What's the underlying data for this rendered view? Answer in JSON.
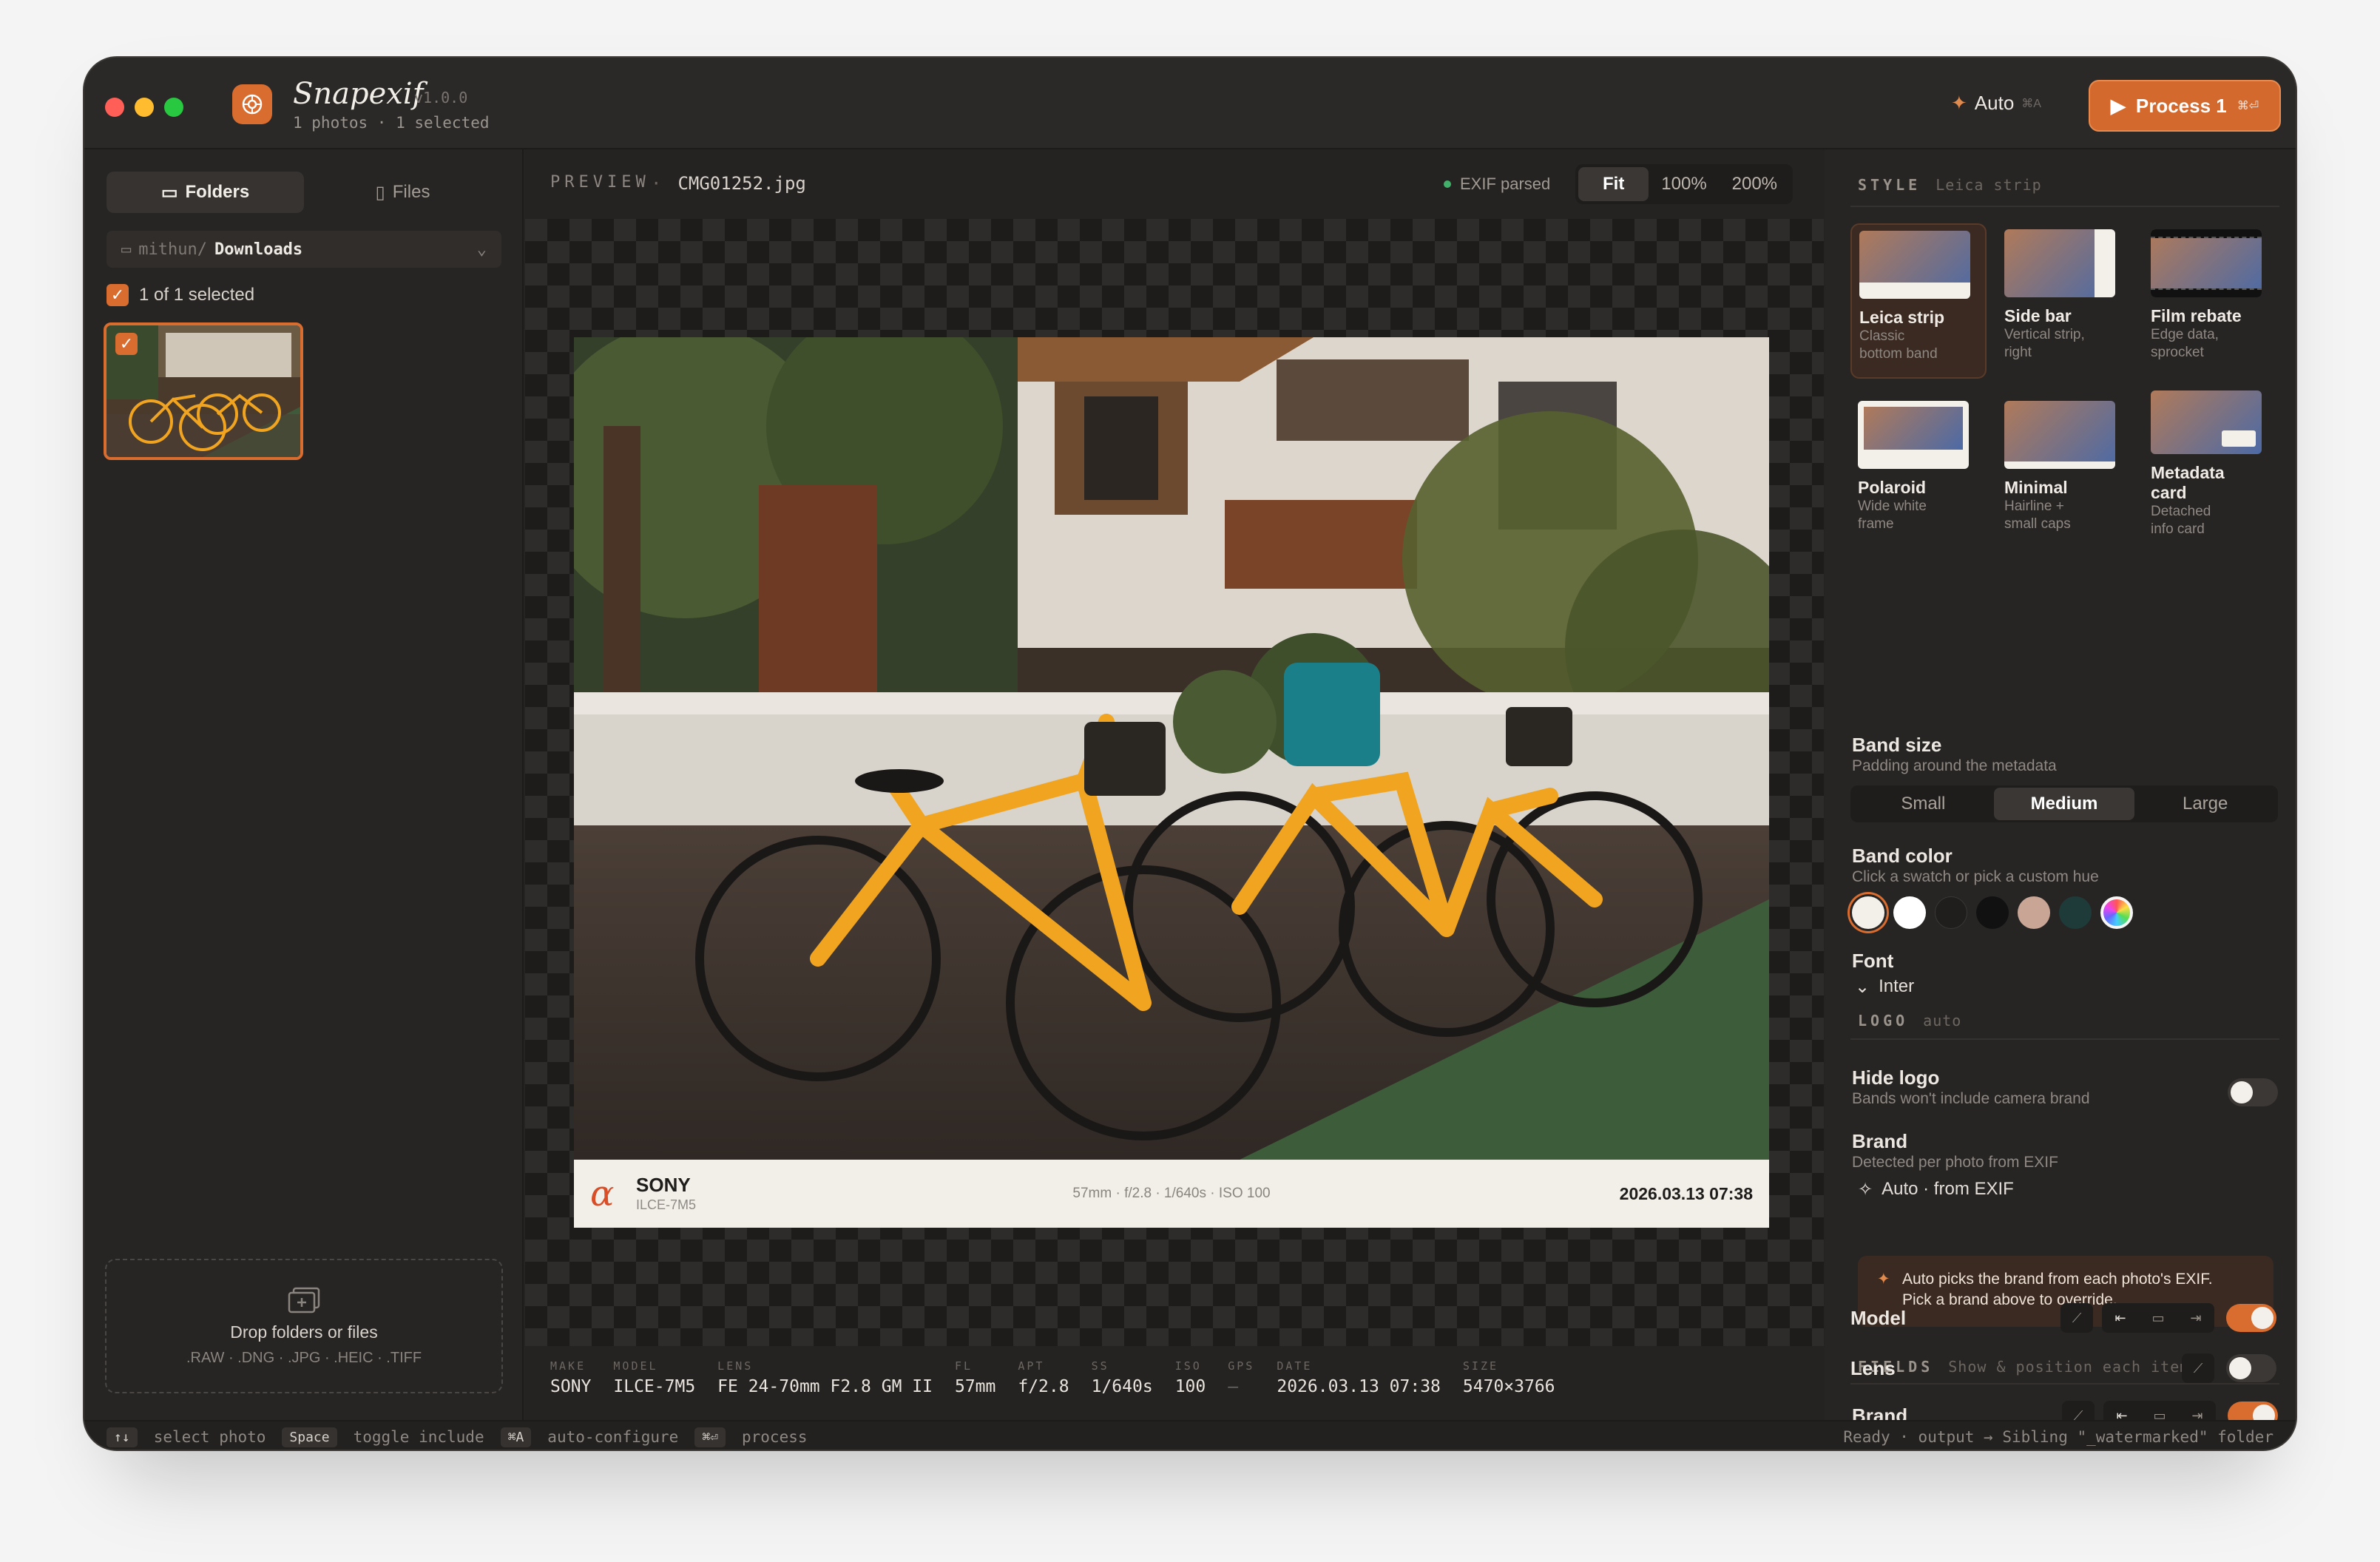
{
  "app": {
    "name": "Snapexif",
    "version": "v1.0.0",
    "subtitle": "1 photos · 1 selected"
  },
  "titlebar": {
    "auto_label": "Auto",
    "auto_shortcut": "⌘A",
    "process_label": "Process 1",
    "process_shortcut": "⌘⏎"
  },
  "sidebar": {
    "tabs": [
      {
        "label": "Folders",
        "active": true
      },
      {
        "label": "Files",
        "active": false
      }
    ],
    "path": {
      "prefix": "mithun/",
      "current": "Downloads"
    },
    "selection_text": "1 of 1 selected",
    "dropzone": {
      "title": "Drop folders or files",
      "formats": ".RAW · .DNG · .JPG · .HEIC · .TIFF"
    }
  },
  "preview": {
    "header": "PREVIEW",
    "separator": "·",
    "filename": "CMG01252.jpg",
    "exif_status": "EXIF parsed",
    "zoom_options": [
      {
        "label": "Fit",
        "active": true
      },
      {
        "label": "100%",
        "active": false
      },
      {
        "label": "200%",
        "active": false
      }
    ],
    "band": {
      "logo_glyph": "α",
      "brand": "SONY",
      "model": "ILCE-7M5",
      "settings": "57mm · f/2.8 · 1/640s · ISO 100",
      "date": "2026.03.13 07:38"
    }
  },
  "metadata": [
    {
      "label": "MAKE",
      "value": "SONY"
    },
    {
      "label": "MODEL",
      "value": "ILCE-7M5"
    },
    {
      "label": "LENS",
      "value": "FE 24-70mm F2.8 GM II"
    },
    {
      "label": "FL",
      "value": "57mm"
    },
    {
      "label": "APT",
      "value": "f/2.8"
    },
    {
      "label": "SS",
      "value": "1/640s"
    },
    {
      "label": "ISO",
      "value": "100"
    },
    {
      "label": "GPS",
      "value": "—"
    },
    {
      "label": "DATE",
      "value": "2026.03.13 07:38"
    },
    {
      "label": "SIZE",
      "value": "5470×3766"
    }
  ],
  "style_panel": {
    "header": "STYLE",
    "current": "Leica strip",
    "styles": [
      {
        "name": "Leica strip",
        "desc": "Classic bottom band",
        "active": true
      },
      {
        "name": "Side bar",
        "desc": "Vertical strip, right",
        "active": false
      },
      {
        "name": "Film rebate",
        "desc": "Edge data, sprocket",
        "active": false
      },
      {
        "name": "Polaroid",
        "desc": "Wide white frame",
        "active": false
      },
      {
        "name": "Minimal",
        "desc": "Hairline + small caps",
        "active": false
      },
      {
        "name": "Metadata card",
        "desc": "Detached info card",
        "active": false
      }
    ],
    "band_size": {
      "label": "Band size",
      "hint": "Padding around the metadata",
      "options": [
        {
          "label": "Small",
          "active": false
        },
        {
          "label": "Medium",
          "active": true
        },
        {
          "label": "Large",
          "active": false
        }
      ]
    },
    "band_color": {
      "label": "Band color",
      "hint": "Click a swatch or pick a custom hue",
      "swatches": [
        "#f3efe9",
        "#ffffff",
        "#1f1e1d",
        "#111111",
        "#c9a596",
        "#1e3b3a",
        "rainbow"
      ],
      "selected": 0
    },
    "font": {
      "label": "Font",
      "value": "Inter"
    },
    "logo": {
      "header": "LOGO",
      "sub": "auto",
      "hide_label": "Hide logo",
      "hide_hint": "Bands won't include camera brand",
      "hide_on": false,
      "brand_label": "Brand",
      "brand_hint": "Detected per photo from EXIF",
      "brand_value": "Auto · from EXIF",
      "info_line1": "Auto picks the brand from each photo's EXIF.",
      "info_line2": "Pick a brand above to override."
    },
    "fields": {
      "header": "FIELDS",
      "sub": "Show & position each item",
      "items": [
        {
          "name": "Brand",
          "on": true
        },
        {
          "name": "Model",
          "on": true
        },
        {
          "name": "Lens",
          "on": false
        }
      ]
    }
  },
  "statusbar": {
    "hint1_key": "↑↓",
    "hint1": "select photo",
    "hint2_key": "Space",
    "hint2": "toggle include",
    "hint3_key": "⌘A",
    "hint3": "auto-configure",
    "hint4_key": "⌘⏎",
    "hint4": "process",
    "right": "Ready · output → Sibling \"_watermarked\" folder"
  },
  "colors": {
    "accent": "#d96c2f",
    "window_bg": "#262423",
    "panel_bg": "#272524"
  }
}
